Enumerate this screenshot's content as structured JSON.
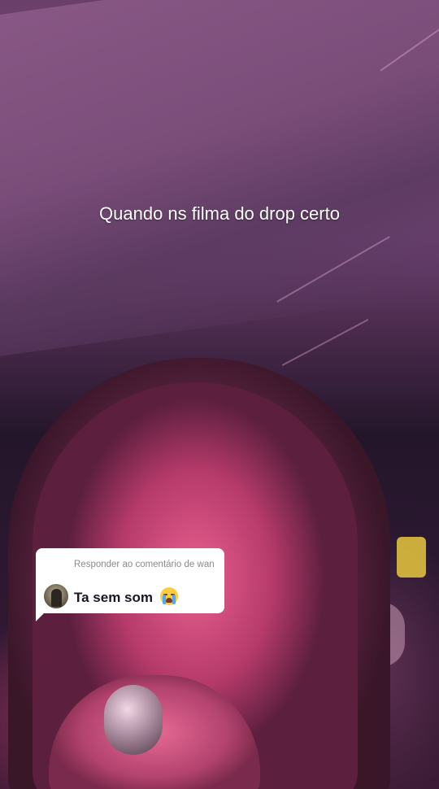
{
  "video": {
    "caption": "Quando ns filma do drop certo"
  },
  "reply": {
    "header": "Responder ao comentário de wan",
    "comment": "Ta sem som",
    "emoji": "loudly-crying-face-icon",
    "avatar": "commenter-avatar"
  },
  "colors": {
    "bubble_bg": "#ffffff",
    "header_text": "#8a8a8a",
    "comment_text": "#161823",
    "caption_text": "#ffffff"
  }
}
